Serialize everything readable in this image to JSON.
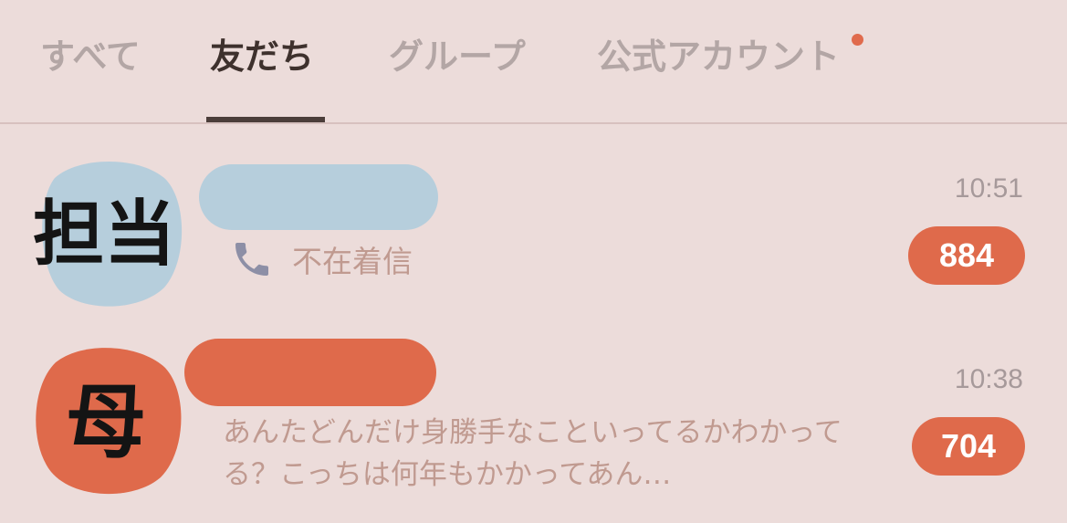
{
  "tabs": [
    {
      "label": "すべて",
      "active": false
    },
    {
      "label": "友だち",
      "active": true
    },
    {
      "label": "グループ",
      "active": false
    },
    {
      "label": "公式アカウント",
      "active": false,
      "has_notification_dot": true
    }
  ],
  "chats": [
    {
      "avatar_text": "担当",
      "avatar_color": "#b6cedc",
      "name_redaction_color": "#b6cedc",
      "preview_icon": "phone-icon",
      "preview": "不在着信",
      "time": "10:51",
      "unread": "884"
    },
    {
      "avatar_text": "母",
      "avatar_color": "#df6a4b",
      "name_redaction_color": "#df6a4b",
      "preview": "あんたどんだけ身勝手なこといってるかわかってる？こっちは何年もかかってあん…",
      "time": "10:38",
      "unread": "704"
    }
  ],
  "colors": {
    "background": "#ecdcda",
    "accent": "#df6a4b",
    "active_tab": "#3e312d",
    "inactive_tab": "#b3a6a5"
  }
}
